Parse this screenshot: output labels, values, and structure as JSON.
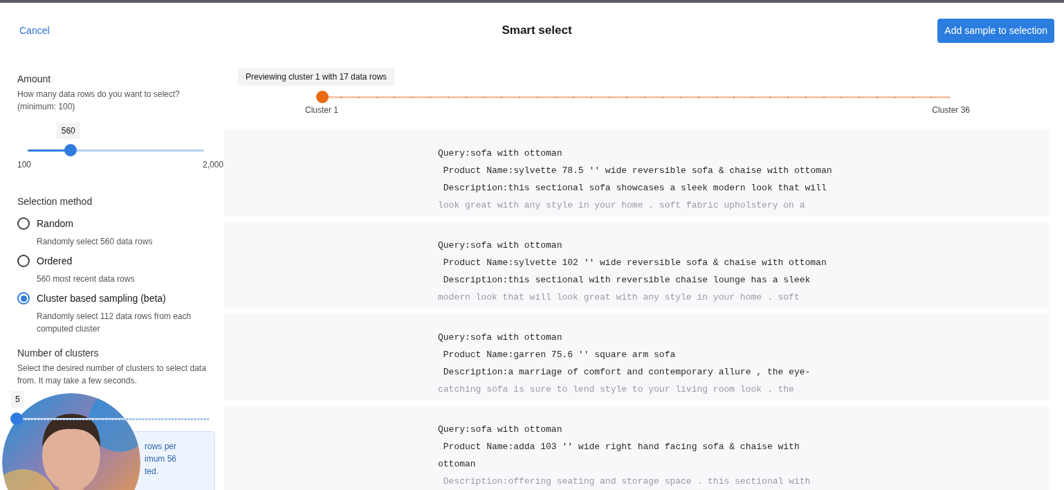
{
  "header": {
    "cancel": "Cancel",
    "title": "Smart select",
    "primary_button": "Add sample to selection"
  },
  "amount": {
    "title": "Amount",
    "help": "How many data rows do you want to select? (minimum: 100)",
    "value": "560",
    "level": 0.242,
    "min_label": "100",
    "max_label": "2,000"
  },
  "selection_method": {
    "title": "Selection method",
    "options": [
      {
        "label": "Random",
        "description": "Randomly select 560 data rows",
        "selected": false
      },
      {
        "label": "Ordered",
        "description": "560 most recent data rows",
        "selected": false
      },
      {
        "label": "Cluster based sampling (beta)",
        "description": "Randomly select 112 data rows from each computed cluster",
        "selected": true
      }
    ]
  },
  "clusters": {
    "title": "Number of clusters",
    "help": "Select the desired number of clusters to select data from. It may take a few seconds.",
    "value": "5",
    "level": 0,
    "info_lines": [
      "rows per",
      "imum 56",
      "ted."
    ]
  },
  "preview": {
    "label": "Previewing cluster 1 with 17 data rows",
    "level": 0,
    "min_label": "Cluster 1",
    "max_label": "Cluster 36"
  },
  "rows": [
    {
      "lines": [
        "Query:sofa with ottoman",
        " Product Name:sylvette 78.5 '' wide reversible sofa & chaise with ottoman",
        " Description:this sectional sofa showcases a sleek modern look that will",
        "look great with any style in your home . soft fabric upholstery on a"
      ]
    },
    {
      "lines": [
        "Query:sofa with ottoman",
        " Product Name:sylvette 102 '' wide reversible sofa & chaise with ottoman",
        " Description:this sectional with reversible chaise lounge has a sleek",
        "modern look that will look great with any style in your home . soft"
      ]
    },
    {
      "lines": [
        "Query:sofa with ottoman",
        " Product Name:garren 75.6 '' square arm sofa",
        " Description:a marriage of comfort and contemporary allure , the eye-",
        "catching sofa is sure to lend style to your living room look . the"
      ]
    },
    {
      "lines": [
        "Query:sofa with ottoman",
        " Product Name:adda 103 '' wide right hand facing sofa & chaise with",
        "ottoman",
        " Description:offering seating and storage space . this sectional with"
      ]
    }
  ]
}
